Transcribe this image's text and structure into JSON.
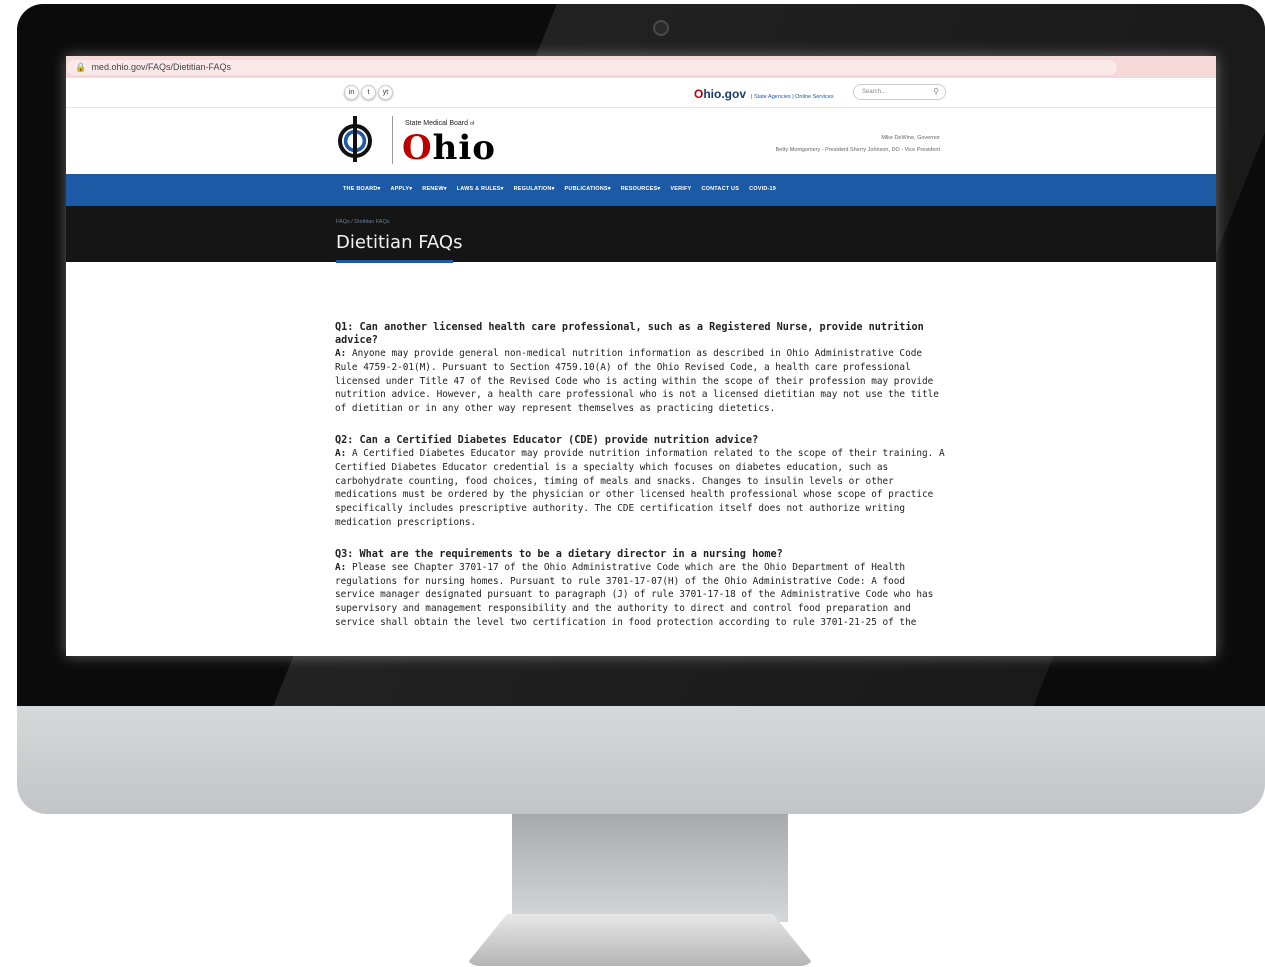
{
  "browser": {
    "url": "med.ohio.gov/FAQs/Dietitian-FAQs",
    "back_icon": "arrow-left-icon",
    "forward_icon": "arrow-right-icon",
    "reload_icon": "reload-icon"
  },
  "util": {
    "social": [
      "in",
      "t",
      "yt"
    ],
    "ohiogov_o": "O",
    "ohiogov_rest": "hio.gov",
    "links": "| State Agencies | Online Services",
    "search_placeholder": "Search..."
  },
  "header": {
    "board_label": "State Medical Board",
    "board_of": "of",
    "ohio_first": "O",
    "ohio_rest": "hio",
    "governor": "Mike DeWine, Governor",
    "officers": "Betty Montgomery - President    Sherry Johnson, DO - Vice President"
  },
  "nav": {
    "items": [
      "THE BOARD▾",
      "APPLY▾",
      "RENEW▾",
      "LAWS & RULES▾",
      "REGULATION▾",
      "PUBLICATIONS▾",
      "RESOURCES▾",
      "VERIFY",
      "CONTACT US",
      "COVID-19"
    ]
  },
  "page": {
    "breadcrumb": "FAQs / Dietitian FAQs",
    "title": "Dietitian FAQs"
  },
  "faqs": [
    {
      "question": "Q1: Can another licensed health care professional, such as a Registered Nurse, provide nutrition advice?",
      "answer_prefix": "A:",
      "answer": " Anyone may provide general non-medical nutrition information as described in Ohio Administrative Code Rule 4759-2-01(M). Pursuant to Section 4759.10(A) of the Ohio Revised Code, a health care professional licensed under Title 47 of the Revised Code who is acting within the scope of their profession may provide nutrition advice. However, a health care professional who is not a licensed dietitian may not use the title of dietitian or in any other way represent themselves as practicing dietetics."
    },
    {
      "question": "Q2: Can a Certified Diabetes Educator (CDE) provide nutrition advice?",
      "answer_prefix": "A:",
      "answer": " A Certified Diabetes Educator may provide nutrition information related to the scope of their training. A Certified Diabetes Educator credential is a specialty which focuses on diabetes education, such as carbohydrate counting, food choices, timing of meals and snacks. Changes to insulin levels or other medications must be ordered by the physician or other licensed health professional whose scope of practice specifically includes prescriptive authority. The CDE certification itself does not authorize writing medication prescriptions."
    },
    {
      "question": "Q3: What are the requirements to be a dietary director in a nursing home?",
      "answer_prefix": "A:",
      "answer": " Please see Chapter 3701-17 of the Ohio Administrative Code which are the Ohio Department of Health regulations for nursing homes. Pursuant to rule 3701-17-07(H) of the Ohio Administrative Code: A food service manager designated pursuant to paragraph (J) of rule 3701-17-18 of the Administrative Code who has supervisory and management responsibility and the authority to direct and control food preparation and service shall obtain the level two certification in food protection according to rule 3701-21-25 of the"
    }
  ]
}
